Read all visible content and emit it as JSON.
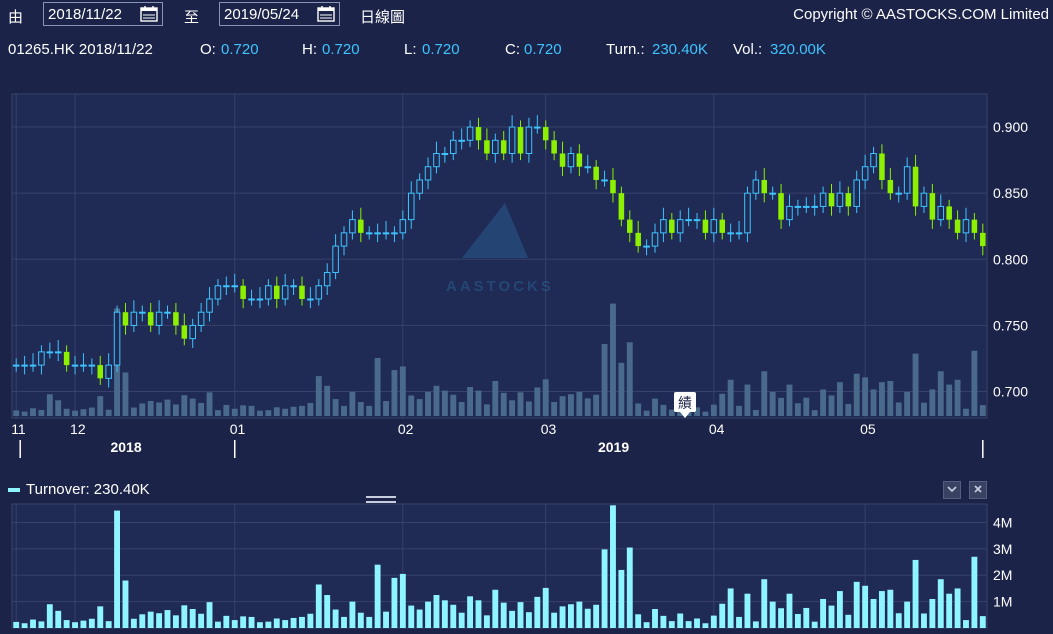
{
  "toolbar": {
    "from_label": "由",
    "from_date": "2018/11/22",
    "to_label": "至",
    "to_date": "2019/05/24",
    "period": "日線圖",
    "copyright": "Copyright © AASTOCKS.COM Limited"
  },
  "quote": {
    "symbol_date": "01265.HK 2018/11/22",
    "o_label": "O:",
    "o": "0.720",
    "h_label": "H:",
    "h": "0.720",
    "l_label": "L:",
    "l": "0.720",
    "c_label": "C:",
    "c": "0.720",
    "turn_label": "Turn.:",
    "turn": "230.40K",
    "vol_label": "Vol.:",
    "vol": "320.00K"
  },
  "watermark": "AASTOCKS",
  "event_marker": "績",
  "colors": {
    "up": "#3fc4ff",
    "down": "#8cf000",
    "bar": "#8ef4ff",
    "vol": "#4a6a8c",
    "axis_text": "#ffffff"
  },
  "turnover_panel": {
    "legend": "Turnover: 230.40K"
  },
  "chart_data": [
    {
      "type": "candlestick",
      "ylim": [
        0.68,
        0.925
      ],
      "yticks": [
        "0.900",
        "0.850",
        "0.800",
        "0.750",
        "0.700"
      ],
      "ytick_values": [
        0.9,
        0.85,
        0.8,
        0.75,
        0.7
      ],
      "xticks": [
        {
          "label": "11",
          "i": 0
        },
        {
          "label": "12",
          "i": 7
        },
        {
          "label": "01",
          "i": 26
        },
        {
          "label": "02",
          "i": 46
        },
        {
          "label": "03",
          "i": 63
        },
        {
          "label": "04",
          "i": 83
        },
        {
          "label": "05",
          "i": 101
        }
      ],
      "years": [
        {
          "label": "2018",
          "i": 13
        },
        {
          "label": "2019",
          "i": 71
        }
      ],
      "closes": [
        0.72,
        0.72,
        0.72,
        0.73,
        0.73,
        0.73,
        0.72,
        0.72,
        0.72,
        0.72,
        0.71,
        0.72,
        0.76,
        0.75,
        0.76,
        0.76,
        0.75,
        0.76,
        0.76,
        0.75,
        0.74,
        0.75,
        0.76,
        0.77,
        0.78,
        0.78,
        0.78,
        0.77,
        0.77,
        0.77,
        0.78,
        0.77,
        0.78,
        0.78,
        0.77,
        0.77,
        0.78,
        0.79,
        0.81,
        0.82,
        0.83,
        0.82,
        0.82,
        0.82,
        0.82,
        0.82,
        0.83,
        0.85,
        0.86,
        0.87,
        0.88,
        0.88,
        0.89,
        0.89,
        0.9,
        0.89,
        0.88,
        0.89,
        0.88,
        0.9,
        0.88,
        0.9,
        0.9,
        0.89,
        0.88,
        0.87,
        0.88,
        0.87,
        0.87,
        0.86,
        0.86,
        0.85,
        0.83,
        0.82,
        0.81,
        0.81,
        0.82,
        0.83,
        0.82,
        0.83,
        0.83,
        0.83,
        0.82,
        0.83,
        0.82,
        0.82,
        0.82,
        0.85,
        0.86,
        0.85,
        0.85,
        0.83,
        0.84,
        0.84,
        0.84,
        0.84,
        0.85,
        0.84,
        0.85,
        0.84,
        0.86,
        0.87,
        0.88,
        0.86,
        0.85,
        0.85,
        0.87,
        0.84,
        0.85,
        0.83,
        0.84,
        0.83,
        0.82,
        0.83,
        0.82,
        0.81
      ],
      "volume_ylim": [
        0,
        4800000
      ]
    },
    {
      "type": "bar",
      "series_name": "Turnover",
      "ylim": [
        0,
        4700000
      ],
      "yticks": [
        "4M",
        "3M",
        "2M",
        "1M"
      ],
      "ytick_values": [
        4000000,
        3000000,
        2000000,
        1000000
      ],
      "values": [
        230400,
        180000,
        320000,
        250000,
        900000,
        650000,
        300000,
        220000,
        280000,
        350000,
        820000,
        260000,
        4450000,
        1800000,
        350000,
        520000,
        620000,
        560000,
        680000,
        480000,
        860000,
        720000,
        540000,
        980000,
        240000,
        460000,
        300000,
        440000,
        420000,
        220000,
        240000,
        360000,
        300000,
        380000,
        420000,
        540000,
        1650000,
        1250000,
        700000,
        420000,
        1000000,
        580000,
        420000,
        2400000,
        620000,
        1900000,
        2050000,
        850000,
        700000,
        1000000,
        1250000,
        1050000,
        880000,
        580000,
        1200000,
        1050000,
        480000,
        1450000,
        960000,
        650000,
        980000,
        600000,
        1180000,
        1520000,
        580000,
        820000,
        900000,
        1000000,
        730000,
        880000,
        2980000,
        4650000,
        2200000,
        3050000,
        520000,
        220000,
        720000,
        460000,
        260000,
        550000,
        260000,
        360000,
        180000,
        470000,
        920000,
        1500000,
        420000,
        1300000,
        250000,
        1850000,
        1000000,
        750000,
        1300000,
        530000,
        760000,
        240000,
        1100000,
        850000,
        1400000,
        500000,
        1750000,
        1600000,
        1100000,
        1400000,
        1450000,
        560000,
        1000000,
        2580000,
        550000,
        1100000,
        1850000,
        1300000,
        1500000,
        300000,
        2700000,
        450000
      ]
    }
  ]
}
